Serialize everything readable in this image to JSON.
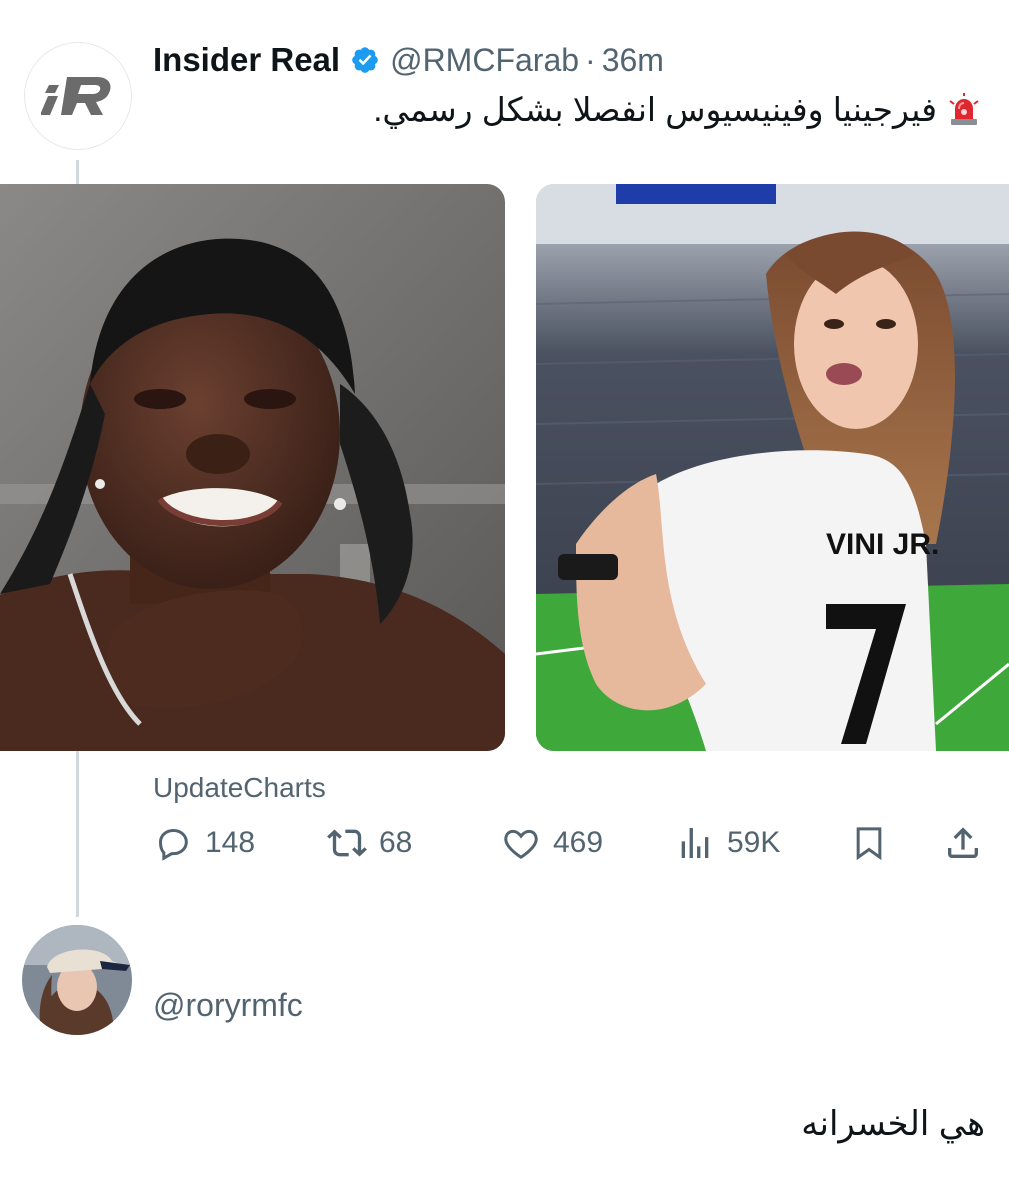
{
  "tweet": {
    "display_name": "Insider Real",
    "handle": "@RMCFarab",
    "separator": "·",
    "time": "36m",
    "text": "فيرجينيا وفينيسيوس انفصلا بشكل رسمي.",
    "emoji": "siren-icon",
    "source": "UpdateCharts",
    "media": [
      {
        "description_icon": "photo-man-selfie"
      },
      {
        "jersey_text": "VINI JR."
      }
    ]
  },
  "actions": {
    "replies": "148",
    "reposts": "68",
    "likes": "469",
    "views": "59K"
  },
  "reply": {
    "handle": "@roryrmfc",
    "text": "هي الخسرانه"
  },
  "colors": {
    "text_primary": "#0f1419",
    "text_secondary": "#536471",
    "verified_blue": "#1d9bf0",
    "thread_line": "#cfd9de"
  }
}
